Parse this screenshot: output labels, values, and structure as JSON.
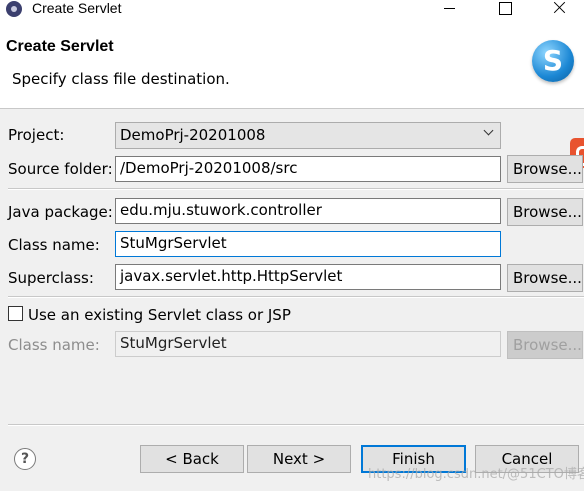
{
  "window": {
    "title": "Create Servlet",
    "app_icon": "eclipse-icon"
  },
  "header": {
    "title": "Create Servlet",
    "description": "Specify class file destination.",
    "icon": "servlet-wizard-icon",
    "icon_letter": "S"
  },
  "form": {
    "project": {
      "label": "Project:",
      "value": "DemoPrj-20201008"
    },
    "source_folder": {
      "label": "Source folder:",
      "value": "/DemoPrj-20201008/src",
      "button": "Browse..."
    },
    "java_package": {
      "label": "Java package:",
      "value": "edu.mju.stuwork.controller",
      "button": "Browse..."
    },
    "class_name": {
      "label": "Class name:",
      "value": "StuMgrServlet"
    },
    "superclass": {
      "label": "Superclass:",
      "value": "javax.servlet.http.HttpServlet",
      "button": "Browse..."
    },
    "use_existing": {
      "label": "Use an existing Servlet class or JSP",
      "checked": false
    },
    "existing_class": {
      "label": "Class name:",
      "value": "StuMgrServlet",
      "button": "Browse..."
    }
  },
  "footer": {
    "help_icon": "?",
    "back": "< Back",
    "next": "Next >",
    "finish": "Finish",
    "cancel": "Cancel"
  },
  "watermark": "https://blog.csdn.net/@51CTO博客",
  "colors": {
    "focus_border": "#0078d7",
    "header_bg": "#ffffff",
    "dialog_bg": "#f0f0f0"
  }
}
